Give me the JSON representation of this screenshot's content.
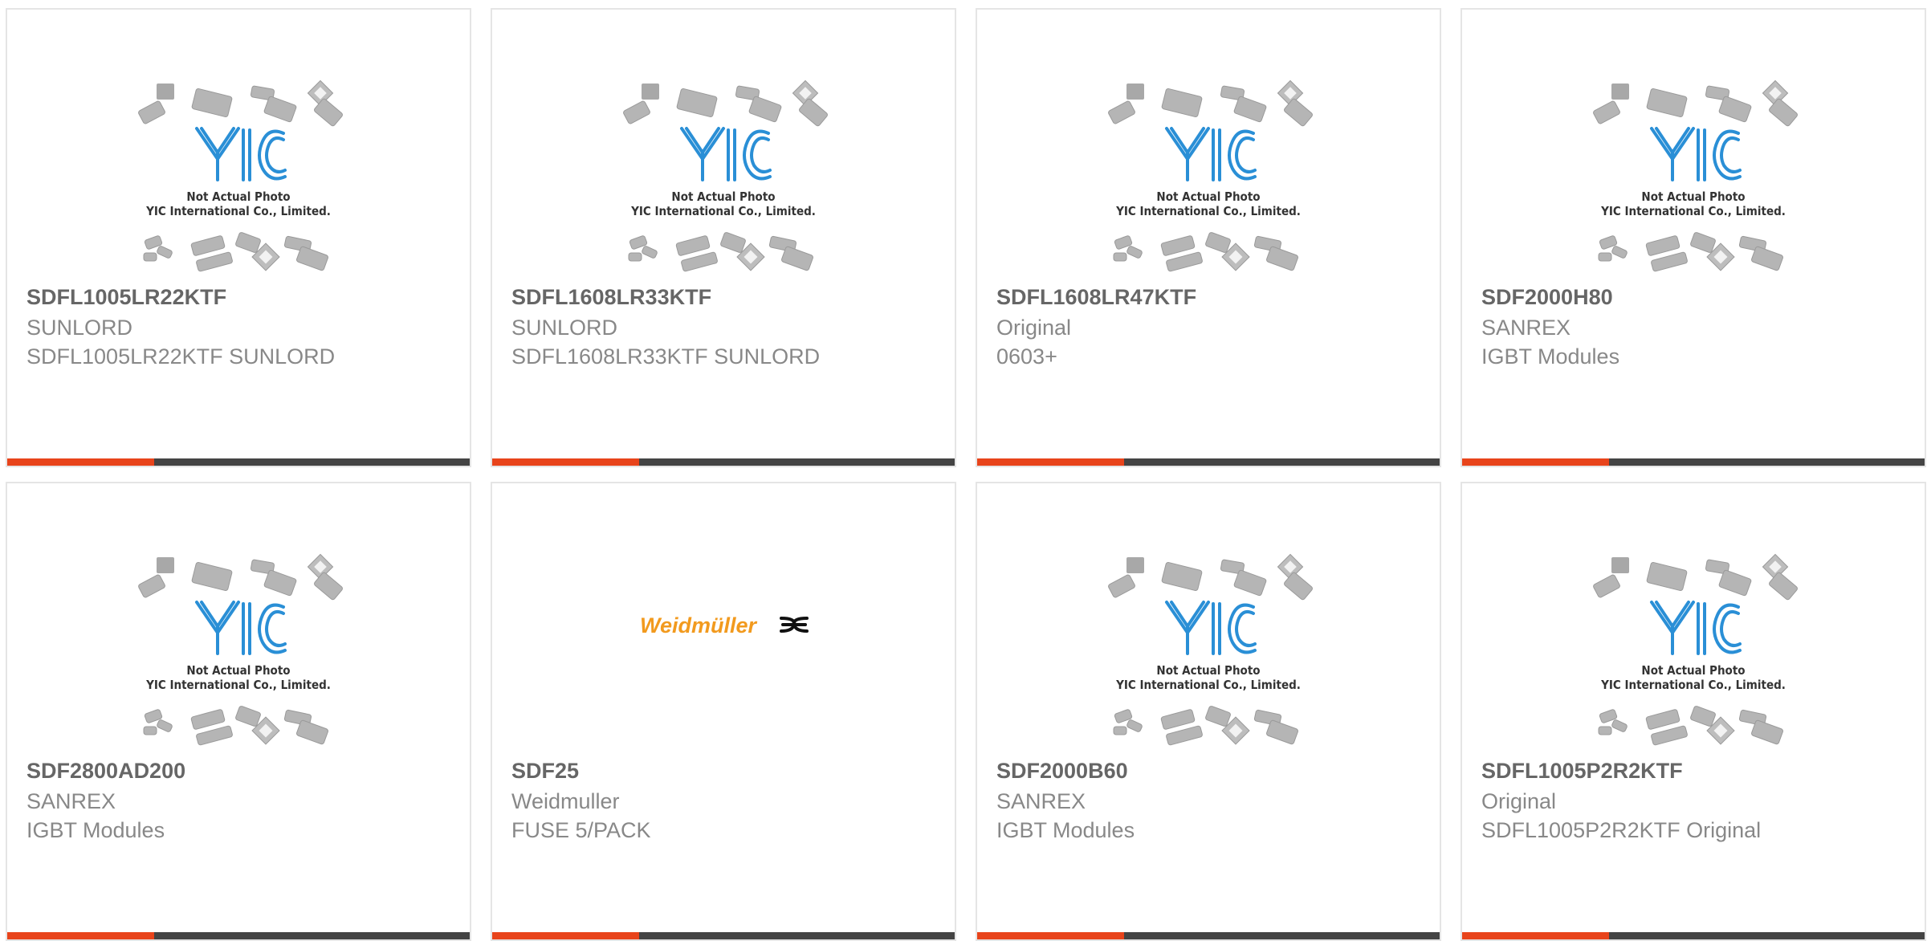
{
  "colors": {
    "accent": "#e8441b",
    "bar_dark": "#444444",
    "border": "#e5e5e5",
    "part_number": "#666666",
    "text": "#888888",
    "logo_blue": "#2a8fd6",
    "weidmuller_orange": "#f29a1e"
  },
  "placeholder": {
    "line1": "Not Actual Photo",
    "line2": "YIC International Co., Limited."
  },
  "weidmuller_logo_text": "Weidmüller",
  "products": [
    {
      "part_number": "SDFL1005LR22KTF",
      "brand": "SUNLORD",
      "description": "SDFL1005LR22KTF SUNLORD",
      "image": "yic-placeholder"
    },
    {
      "part_number": "SDFL1608LR33KTF",
      "brand": "SUNLORD",
      "description": "SDFL1608LR33KTF SUNLORD",
      "image": "yic-placeholder"
    },
    {
      "part_number": "SDFL1608LR47KTF",
      "brand": "Original",
      "description": "0603+",
      "image": "yic-placeholder"
    },
    {
      "part_number": "SDF2000H80",
      "brand": "SANREX",
      "description": "IGBT Modules",
      "image": "yic-placeholder"
    },
    {
      "part_number": "SDF2800AD200",
      "brand": "SANREX",
      "description": "IGBT Modules",
      "image": "yic-placeholder"
    },
    {
      "part_number": "SDF25",
      "brand": "Weidmuller",
      "description": "FUSE 5/PACK",
      "image": "weidmuller-logo"
    },
    {
      "part_number": "SDF2000B60",
      "brand": "SANREX",
      "description": "IGBT Modules",
      "image": "yic-placeholder"
    },
    {
      "part_number": "SDFL1005P2R2KTF",
      "brand": "Original",
      "description": "SDFL1005P2R2KTF Original",
      "image": "yic-placeholder"
    }
  ]
}
